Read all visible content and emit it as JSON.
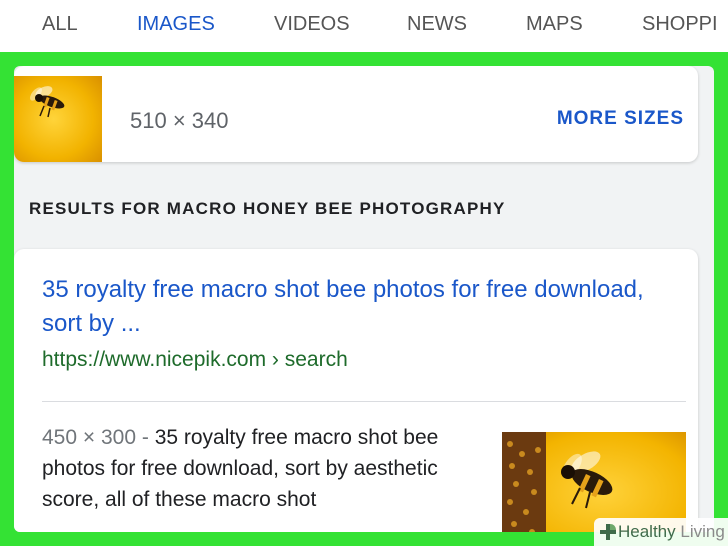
{
  "tabs": [
    {
      "label": "ALL",
      "active": false
    },
    {
      "label": "IMAGES",
      "active": true
    },
    {
      "label": "VIDEOS",
      "active": false
    },
    {
      "label": "NEWS",
      "active": false
    },
    {
      "label": "MAPS",
      "active": false
    },
    {
      "label": "SHOPPI",
      "active": false
    }
  ],
  "image_info": {
    "size": "510 × 340",
    "more_sizes_label": "MORE SIZES"
  },
  "results_heading": "RESULTS FOR MACRO HONEY BEE PHOTOGRAPHY",
  "result": {
    "title": "35 royalty free macro shot bee photos for free download, sort by ...",
    "url": "https://www.nicepik.com › search",
    "dimensions": "450 × 300",
    "separator": " - ",
    "description": "35 royalty free macro shot bee photos for free download, sort by aesthetic score, all of these macro shot"
  },
  "watermark": {
    "brand_bold": "Healthy",
    "brand_light": " Living"
  },
  "colors": {
    "accent_blue": "#1a57c9",
    "url_green": "#1e6b2b",
    "frame_green": "#34e234"
  },
  "icons": {
    "thumbnail": "bee-on-yellow-flower-image",
    "result_thumbnail": "bee-macro-image",
    "watermark_mark": "plus-leaf-icon"
  }
}
